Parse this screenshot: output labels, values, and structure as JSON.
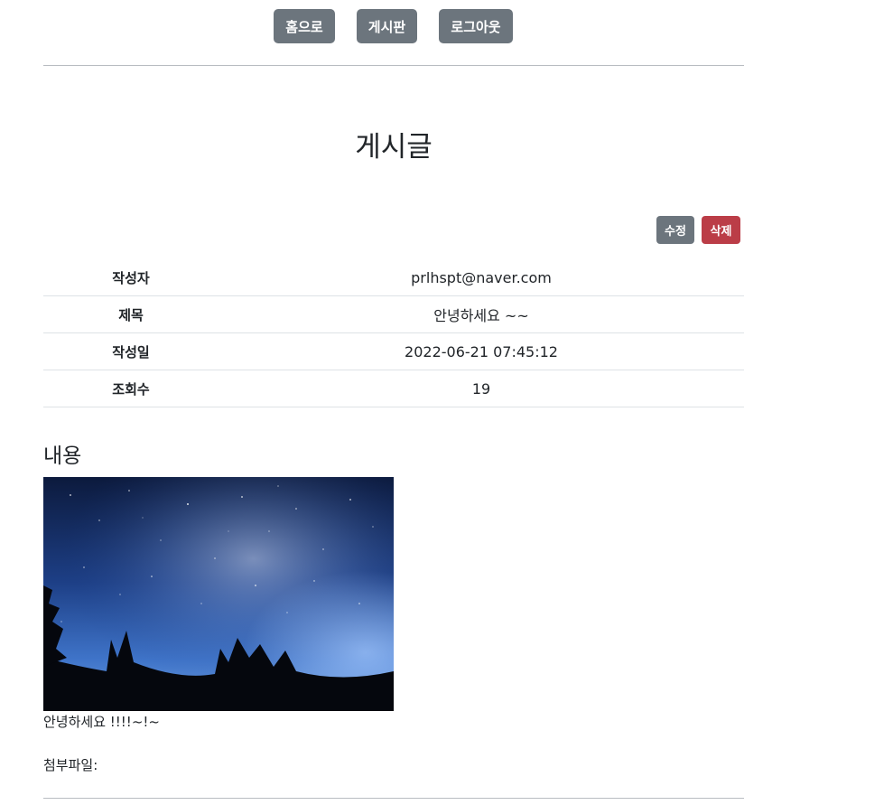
{
  "nav": {
    "home_label": "홈으로",
    "board_label": "게시판",
    "logout_label": "로그아웃"
  },
  "page": {
    "title": "게시글"
  },
  "actions": {
    "edit_label": "수정",
    "delete_label": "삭제"
  },
  "meta": [
    {
      "label": "작성자",
      "value": "prlhspt@naver.com"
    },
    {
      "label": "제목",
      "value": "안녕하세요 ~~"
    },
    {
      "label": "작성일",
      "value": "2022-06-21 07:45:12"
    },
    {
      "label": "조회수",
      "value": "19"
    }
  ],
  "content": {
    "heading": "내용",
    "image_alt": "starry night sky with milky way",
    "text": "안녕하세요 !!!!~!~",
    "attachment_label": "첨부파일:"
  },
  "colors": {
    "secondary": "#6c757d",
    "danger": "#bb3d47",
    "text": "#212529"
  }
}
